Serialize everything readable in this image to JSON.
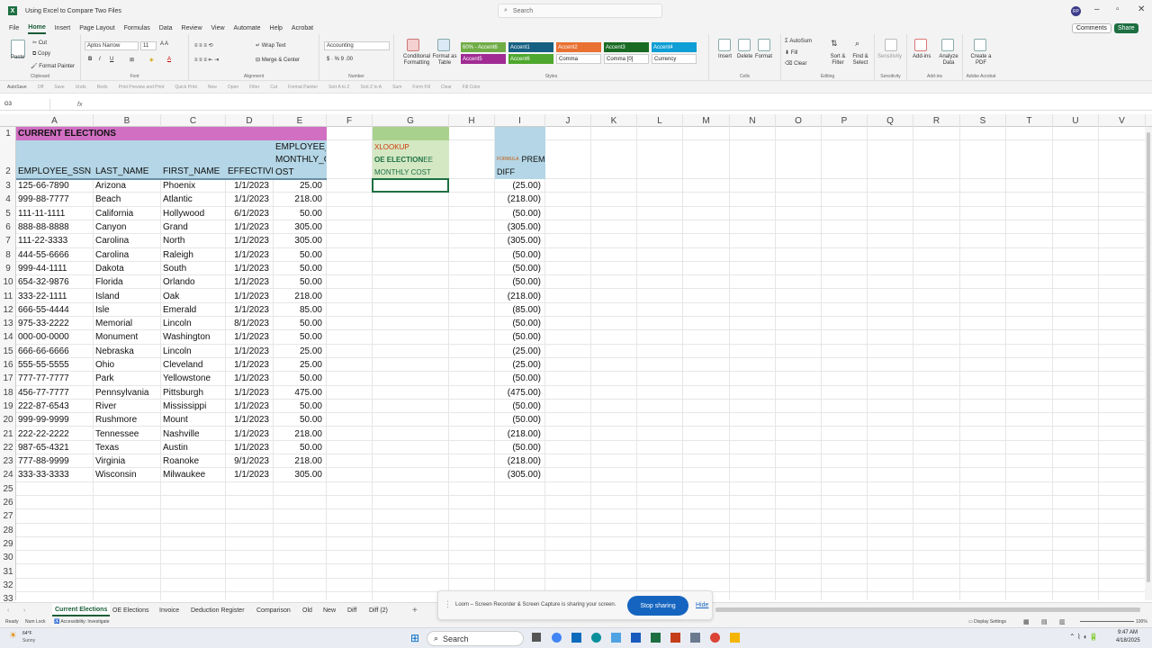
{
  "window": {
    "title": "Using Excel to Compare Two Files",
    "search": "Search",
    "avatar": "RP"
  },
  "menu": [
    "File",
    "Home",
    "Insert",
    "Page Layout",
    "Formulas",
    "Data",
    "Review",
    "View",
    "Automate",
    "Help",
    "Acrobat"
  ],
  "comments": "Comments",
  "share": "Share",
  "ribbon": {
    "clipboard": {
      "paste": "Paste",
      "cut": "Cut",
      "copy": "Copy",
      "painter": "Format Painter",
      "label": "Clipboard"
    },
    "font": {
      "name": "Aptos Narrow",
      "size": "11",
      "label": "Font"
    },
    "alignment": {
      "wrap": "Wrap Text",
      "merge": "Merge & Center",
      "label": "Alignment"
    },
    "number": {
      "format": "Accounting",
      "label": "Number"
    },
    "styles": {
      "cond": "Conditional Formatting",
      "table": "Format as Table",
      "label": "Styles",
      "cells": [
        {
          "t": "60% - Accent6",
          "c": "#70ad47"
        },
        {
          "t": "Accent1",
          "c": "#156082"
        },
        {
          "t": "Accent2",
          "c": "#e97132"
        },
        {
          "t": "Accent3",
          "c": "#196b24"
        },
        {
          "t": "Accent4",
          "c": "#0f9ed5"
        },
        {
          "t": "Accent5",
          "c": "#a02b93"
        },
        {
          "t": "Accent6",
          "c": "#4ea72e"
        },
        {
          "t": "Comma",
          "c": "#ffffff"
        },
        {
          "t": "Comma [0]",
          "c": "#ffffff"
        },
        {
          "t": "Currency",
          "c": "#ffffff"
        }
      ]
    },
    "cells": {
      "insert": "Insert",
      "delete": "Delete",
      "format": "Format",
      "label": "Cells"
    },
    "editing": {
      "autosum": "AutoSum",
      "fill": "Fill",
      "clear": "Clear",
      "sort": "Sort & Filter",
      "find": "Find & Select",
      "label": "Editing"
    },
    "sensitivity": {
      "btn": "Sensitivity",
      "label": "Sensitivity"
    },
    "addins": {
      "btn": "Add-ins",
      "analyze": "Analyze Data",
      "label": "Add-ins"
    },
    "acrobat": {
      "btn": "Create a PDF",
      "label": "Adobe Acrobat"
    }
  },
  "qat": [
    "AutoSave",
    "Off",
    "Save",
    "Undo",
    "Redo",
    "Print Preview and Print",
    "Quick Print",
    "New",
    "Open",
    "Filter",
    "Cut",
    "Format Painter",
    "Sort A to Z",
    "Sort Z to A",
    "Sum",
    "Form Fill",
    "Clear",
    "Fill Color"
  ],
  "namebox": "G3",
  "fx": "fx",
  "columns": [
    "A",
    "B",
    "C",
    "D",
    "E",
    "F",
    "G",
    "H",
    "I",
    "J",
    "K",
    "L",
    "M",
    "N",
    "O",
    "P",
    "Q",
    "R",
    "S",
    "T",
    "U",
    "V"
  ],
  "rows": [
    "1",
    "2",
    "3",
    "4",
    "5",
    "6",
    "7",
    "8",
    "9",
    "10",
    "11",
    "12",
    "13",
    "14",
    "15",
    "16",
    "17",
    "18",
    "19",
    "20",
    "21",
    "22",
    "23",
    "24",
    "25",
    "26",
    "27",
    "28",
    "29",
    "30",
    "31",
    "32",
    "33"
  ],
  "sheet": {
    "title": "CURRENT ELECTIONS",
    "headers": [
      "EMPLOYEE_SSN",
      "LAST_NAME",
      "FIRST_NAME",
      "EFFECTIVE",
      "EMPLOYEE_",
      "MONTHLY_C",
      "OST"
    ],
    "g_header": {
      "l1": "XLOOKUP",
      "l2a": "OE ELECTION",
      "l2b": " EE",
      "l3": "MONTHLY COST"
    },
    "i_header": {
      "formula": "FORMULA",
      "prem": "PREM",
      "diff": "DIFF"
    },
    "data": [
      [
        "125-66-7890",
        "Arizona",
        "Phoenix",
        "1/1/2023",
        "25.00",
        "(25.00)"
      ],
      [
        "999-88-7777",
        "Beach",
        "Atlantic",
        "1/1/2023",
        "218.00",
        "(218.00)"
      ],
      [
        "111-11-1111",
        "California",
        "Hollywood",
        "6/1/2023",
        "50.00",
        "(50.00)"
      ],
      [
        "888-88-8888",
        "Canyon",
        "Grand",
        "1/1/2023",
        "305.00",
        "(305.00)"
      ],
      [
        "111-22-3333",
        "Carolina",
        "North",
        "1/1/2023",
        "305.00",
        "(305.00)"
      ],
      [
        "444-55-6666",
        "Carolina",
        "Raleigh",
        "1/1/2023",
        "50.00",
        "(50.00)"
      ],
      [
        "999-44-1111",
        "Dakota",
        "South",
        "1/1/2023",
        "50.00",
        "(50.00)"
      ],
      [
        "654-32-9876",
        "Florida",
        "Orlando",
        "1/1/2023",
        "50.00",
        "(50.00)"
      ],
      [
        "333-22-1111",
        "Island",
        "Oak",
        "1/1/2023",
        "218.00",
        "(218.00)"
      ],
      [
        "666-55-4444",
        "Isle",
        "Emerald",
        "1/1/2023",
        "85.00",
        "(85.00)"
      ],
      [
        "975-33-2222",
        "Memorial",
        "Lincoln",
        "8/1/2023",
        "50.00",
        "(50.00)"
      ],
      [
        "000-00-0000",
        "Monument",
        "Washington",
        "1/1/2023",
        "50.00",
        "(50.00)"
      ],
      [
        "666-66-6666",
        "Nebraska",
        "Lincoln",
        "1/1/2023",
        "25.00",
        "(25.00)"
      ],
      [
        "555-55-5555",
        "Ohio",
        "Cleveland",
        "1/1/2023",
        "25.00",
        "(25.00)"
      ],
      [
        "777-77-7777",
        "Park",
        "Yellowstone",
        "1/1/2023",
        "50.00",
        "(50.00)"
      ],
      [
        "456-77-7777",
        "Pennsylvania",
        "Pittsburgh",
        "1/1/2023",
        "475.00",
        "(475.00)"
      ],
      [
        "222-87-6543",
        "River",
        "Mississippi",
        "1/1/2023",
        "50.00",
        "(50.00)"
      ],
      [
        "999-99-9999",
        "Rushmore",
        "Mount",
        "1/1/2023",
        "50.00",
        "(50.00)"
      ],
      [
        "222-22-2222",
        "Tennessee",
        "Nashville",
        "1/1/2023",
        "218.00",
        "(218.00)"
      ],
      [
        "987-65-4321",
        "Texas",
        "Austin",
        "1/1/2023",
        "50.00",
        "(50.00)"
      ],
      [
        "777-88-9999",
        "Virginia",
        "Roanoke",
        "9/1/2023",
        "218.00",
        "(218.00)"
      ],
      [
        "333-33-3333",
        "Wisconsin",
        "Milwaukee",
        "1/1/2023",
        "305.00",
        "(305.00)"
      ]
    ]
  },
  "tabs": [
    "Current Elections",
    "OE Elections",
    "Invoice",
    "Deduction Register",
    "Comparison",
    "Old",
    "New",
    "Diff",
    "Diff (2)"
  ],
  "status": {
    "ready": "Ready",
    "numlock": "Num Lock",
    "access": "Accessibility: Investigate",
    "display": "Display Settings",
    "zoom": "100%"
  },
  "share_bar": {
    "msg": "Loom – Screen Recorder & Screen Capture is sharing your screen.",
    "stop": "Stop sharing",
    "hide": "Hide"
  },
  "taskbar": {
    "temp": "64°F",
    "weather": "Sunny",
    "search": "Search",
    "time": "9:47 AM",
    "date": "4/18/2025"
  },
  "colors": {
    "title_fill": "#d16fc3",
    "header_fill": "#b4d6e6",
    "xlookup_fill": "#a9d18e",
    "excel_green": "#1d6f42"
  }
}
